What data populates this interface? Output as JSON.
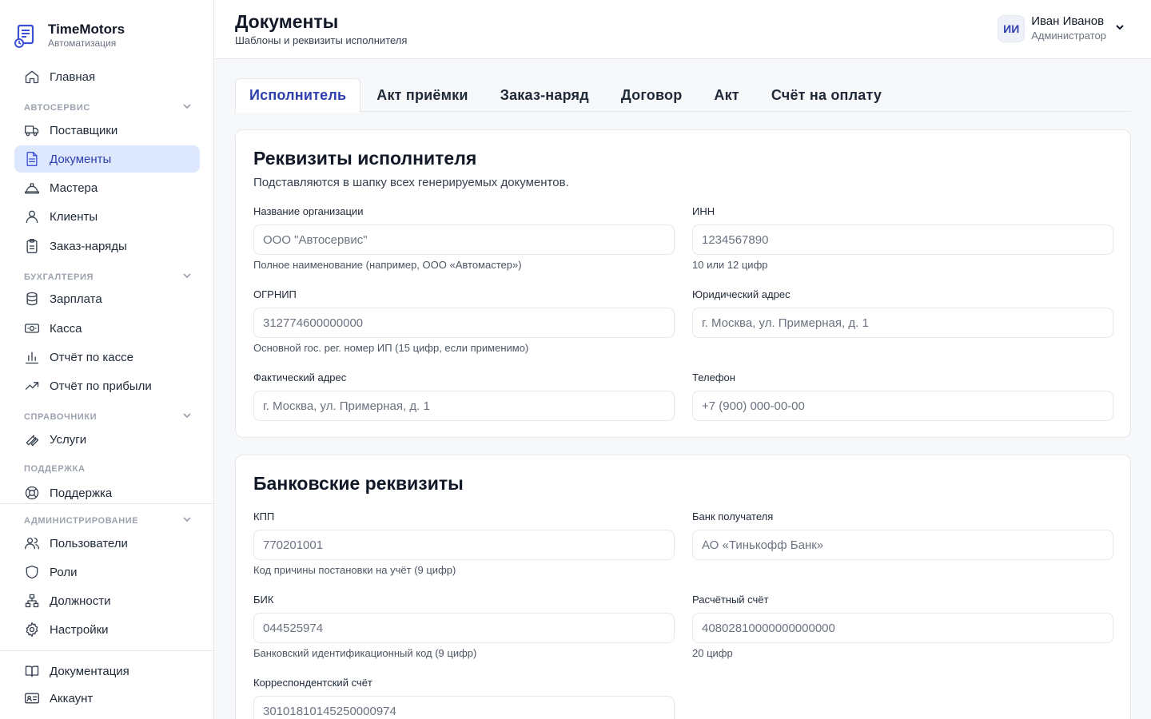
{
  "brand": {
    "name": "TimeMotors",
    "subtitle": "Автоматизация"
  },
  "nav": {
    "home": "Главная",
    "sec_autoservice": "Автосервис",
    "suppliers": "Поставщики",
    "documents": "Документы",
    "masters": "Мастера",
    "clients": "Клиенты",
    "orders": "Заказ-наряды",
    "sec_accounting": "Бухгалтерия",
    "salary": "Зарплата",
    "cashbox": "Касса",
    "cash_report": "Отчёт по кассе",
    "profit_report": "Отчёт по прибыли",
    "sec_reference": "Справочники",
    "services": "Услуги",
    "sec_support": "Поддержка",
    "support": "Поддержка",
    "sec_admin": "Администрирование",
    "users": "Пользователи",
    "roles": "Роли",
    "positions": "Должности",
    "settings": "Настройки",
    "docs": "Документация",
    "account": "Аккаунт"
  },
  "header": {
    "title": "Документы",
    "subtitle": "Шаблоны и реквизиты исполнителя",
    "user": {
      "initials": "ИИ",
      "name": "Иван Иванов",
      "role": "Администратор"
    }
  },
  "tabs": [
    {
      "label": "Исполнитель",
      "active": true
    },
    {
      "label": "Акт приёмки"
    },
    {
      "label": "Заказ-наряд"
    },
    {
      "label": "Договор"
    },
    {
      "label": "Акт"
    },
    {
      "label": "Счёт на оплату"
    }
  ],
  "executor": {
    "title": "Реквизиты исполнителя",
    "desc": "Подставляются в шапку всех генерируемых документов.",
    "org": {
      "label": "Название организации",
      "placeholder": "ООО \"Автосервис\"",
      "hint": "Полное наименование (например, ООО «Автомастер»)"
    },
    "inn": {
      "label": "ИНН",
      "placeholder": "1234567890",
      "hint": "10 или 12 цифр"
    },
    "ogrnip": {
      "label": "ОГРНИП",
      "placeholder": "312774600000000",
      "hint": "Основной гос. рег. номер ИП (15 цифр, если применимо)"
    },
    "legal_address": {
      "label": "Юридический адрес",
      "placeholder": "г. Москва, ул. Примерная, д. 1"
    },
    "actual_address": {
      "label": "Фактический адрес",
      "placeholder": "г. Москва, ул. Примерная, д. 1"
    },
    "phone": {
      "label": "Телефон",
      "placeholder": "+7 (900) 000-00-00"
    }
  },
  "bank": {
    "title": "Банковские реквизиты",
    "kpp": {
      "label": "КПП",
      "placeholder": "770201001",
      "hint": "Код причины постановки на учёт (9 цифр)"
    },
    "bank_name": {
      "label": "Банк получателя",
      "placeholder": "АО «Тинькофф Банк»"
    },
    "bik": {
      "label": "БИК",
      "placeholder": "044525974",
      "hint": "Банковский идентификационный код (9 цифр)"
    },
    "account": {
      "label": "Расчётный счёт",
      "placeholder": "40802810000000000000",
      "hint": "20 цифр"
    },
    "corr_account": {
      "label": "Корреспондентский счёт",
      "placeholder": "30101810145250000974"
    }
  }
}
